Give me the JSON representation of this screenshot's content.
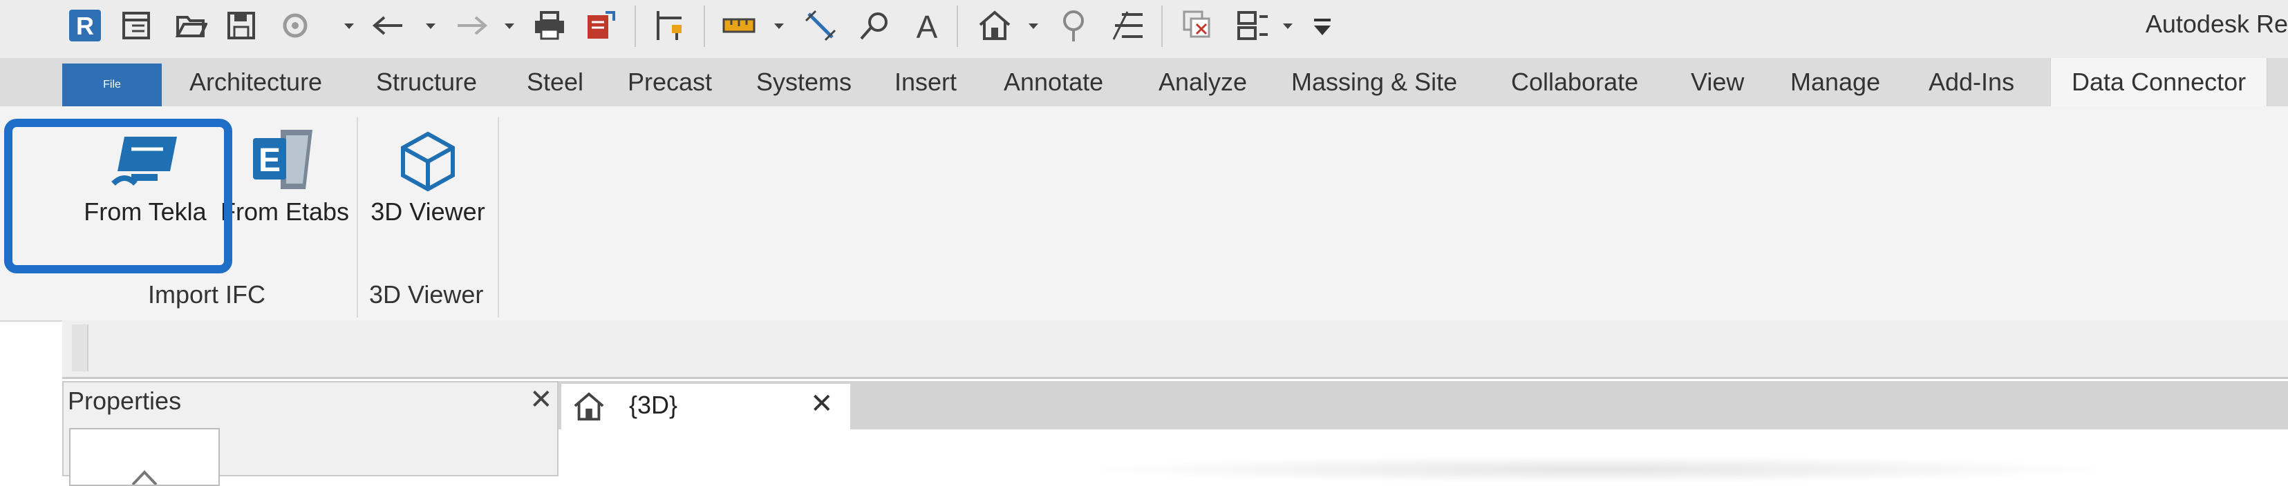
{
  "app": {
    "title": "Autodesk Re",
    "accent_color": "#2f6fb3"
  },
  "quick_access": {
    "icons": [
      "revit-logo-icon",
      "open-document-icon",
      "open-folder-icon",
      "save-icon",
      "sync-icon",
      "undo-icon",
      "redo-icon",
      "print-icon",
      "export-icon",
      "measure-icon",
      "dimension-icon",
      "tag-icon",
      "text-icon",
      "home-view-icon",
      "section-icon",
      "thin-lines-icon",
      "close-hidden-icon",
      "switch-windows-icon",
      "customize-icon"
    ]
  },
  "tabs": [
    {
      "label": "File"
    },
    {
      "label": "Architecture"
    },
    {
      "label": "Structure"
    },
    {
      "label": "Steel"
    },
    {
      "label": "Precast"
    },
    {
      "label": "Systems"
    },
    {
      "label": "Insert"
    },
    {
      "label": "Annotate"
    },
    {
      "label": "Analyze"
    },
    {
      "label": "Massing & Site"
    },
    {
      "label": "Collaborate"
    },
    {
      "label": "View"
    },
    {
      "label": "Manage"
    },
    {
      "label": "Add-Ins"
    },
    {
      "label": "Data Connector"
    }
  ],
  "ribbon": {
    "buttons": [
      {
        "label": "From Tekla",
        "icon": "tekla-icon"
      },
      {
        "label": "From Etabs",
        "icon": "etabs-icon"
      },
      {
        "label": "3D Viewer",
        "icon": "cube-icon"
      }
    ],
    "panels": [
      {
        "label": "Import IFC"
      },
      {
        "label": "3D Viewer"
      }
    ]
  },
  "properties": {
    "title": "Properties",
    "close": "✕"
  },
  "view_tab": {
    "label": "{3D}",
    "close": "✕"
  }
}
